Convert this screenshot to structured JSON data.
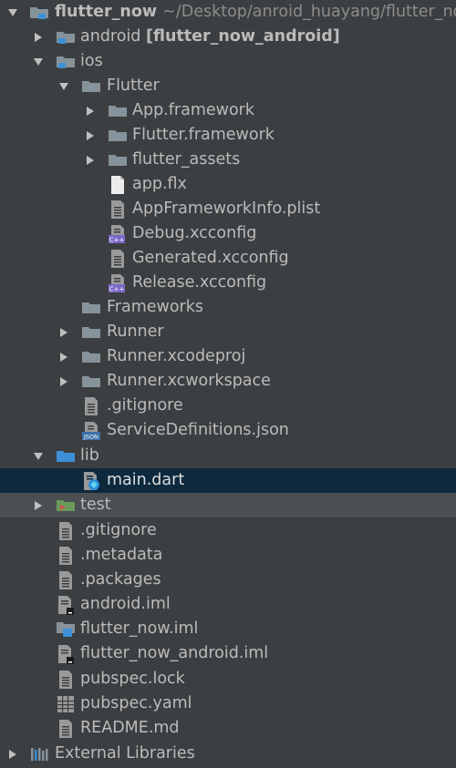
{
  "tree": {
    "root": {
      "name": "flutter_now",
      "path": "~/Desktop/anroid_huayang/flutter_now"
    },
    "android": {
      "name": "android",
      "module": "[flutter_now_android]"
    },
    "ios": {
      "name": "ios"
    },
    "flutter_dir": {
      "name": "Flutter"
    },
    "app_framework": {
      "name": "App.framework"
    },
    "flutter_framework": {
      "name": "Flutter.framework"
    },
    "flutter_assets": {
      "name": "flutter_assets"
    },
    "app_flx": {
      "name": "app.flx"
    },
    "app_framework_info": {
      "name": "AppFrameworkInfo.plist"
    },
    "debug_xcconfig": {
      "name": "Debug.xcconfig"
    },
    "generated_xcconfig": {
      "name": "Generated.xcconfig"
    },
    "release_xcconfig": {
      "name": "Release.xcconfig"
    },
    "frameworks": {
      "name": "Frameworks"
    },
    "runner": {
      "name": "Runner"
    },
    "runner_xcodeproj": {
      "name": "Runner.xcodeproj"
    },
    "runner_xcworkspace": {
      "name": "Runner.xcworkspace"
    },
    "ios_gitignore": {
      "name": ".gitignore"
    },
    "service_definitions": {
      "name": "ServiceDefinitions.json"
    },
    "lib": {
      "name": "lib"
    },
    "main_dart": {
      "name": "main.dart"
    },
    "test": {
      "name": "test"
    },
    "root_gitignore": {
      "name": ".gitignore"
    },
    "metadata": {
      "name": ".metadata"
    },
    "packages": {
      "name": ".packages"
    },
    "android_iml": {
      "name": "android.iml"
    },
    "flutter_now_iml": {
      "name": "flutter_now.iml"
    },
    "flutter_now_android_iml": {
      "name": "flutter_now_android.iml"
    },
    "pubspec_lock": {
      "name": "pubspec.lock"
    },
    "pubspec_yaml": {
      "name": "pubspec.yaml"
    },
    "readme": {
      "name": "README.md"
    },
    "external_libraries": {
      "name": "External Libraries"
    }
  },
  "colors": {
    "background": "#3c3f41",
    "selection": "#0d293e",
    "hover": "#4b4f52",
    "text": "#bbbbbb",
    "path_text": "#8c8c8c",
    "folder": "#87939a",
    "blue_folder": "#3d8fd6",
    "json_badge": "#3d6fa8",
    "cpp_badge": "#7b68c8"
  }
}
